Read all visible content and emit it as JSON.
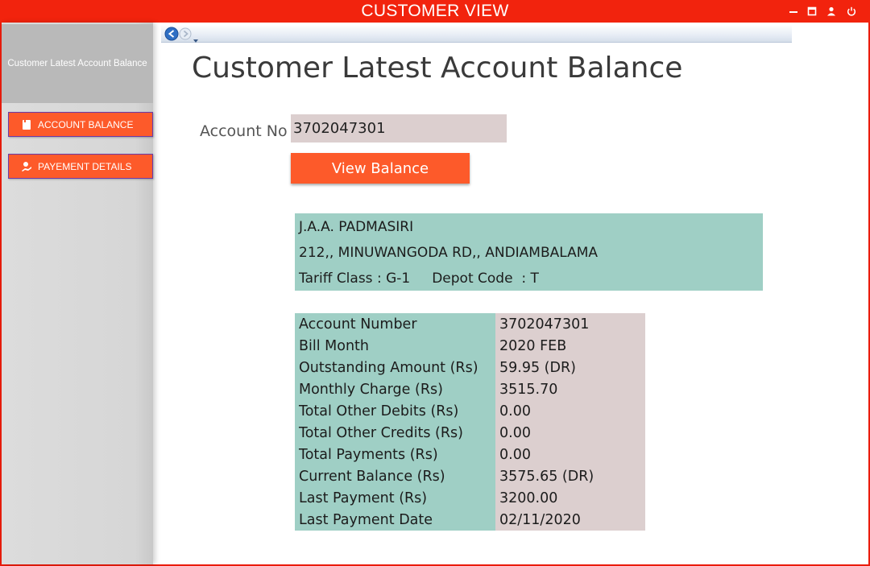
{
  "window": {
    "title": "CUSTOMER VIEW"
  },
  "sidebar": {
    "header": "Customer Latest Account Balance",
    "buttons": [
      {
        "label": "ACCOUNT BALANCE",
        "icon": "receipt-icon"
      },
      {
        "label": "PAYEMENT DETAILS",
        "icon": "payment-icon"
      }
    ]
  },
  "main": {
    "title": "Customer Latest Account Balance",
    "account_label": "Account No",
    "account_value": "3702047301",
    "view_button": "View Balance",
    "customer": {
      "name": "J.A.A. PADMASIRI",
      "address": "212,, MINUWANGODA RD,, ANDIAMBALAMA",
      "tariff_line": "Tariff Class : G-1     Depot Code  : T"
    },
    "balance_rows": [
      {
        "label": "Account Number",
        "value": "3702047301"
      },
      {
        "label": "Bill Month",
        "value": "2020 FEB"
      },
      {
        "label": "Outstanding Amount (Rs)",
        "value": "59.95 (DR)"
      },
      {
        "label": "Monthly Charge (Rs)",
        "value": "3515.70"
      },
      {
        "label": "Total Other Debits (Rs)",
        "value": "0.00"
      },
      {
        "label": "Total Other Credits (Rs)",
        "value": "0.00"
      },
      {
        "label": "Total Payments (Rs)",
        "value": "0.00"
      },
      {
        "label": "Current Balance (Rs)",
        "value": "3575.65 (DR)"
      },
      {
        "label": "Last Payment (Rs)",
        "value": "3200.00"
      },
      {
        "label": "Last Payment Date",
        "value": "02/11/2020"
      }
    ]
  },
  "colors": {
    "titlebar": "#f2230d",
    "button": "#fd5a2a",
    "teal": "#9fcfc5",
    "pink": "#dccfcf"
  }
}
